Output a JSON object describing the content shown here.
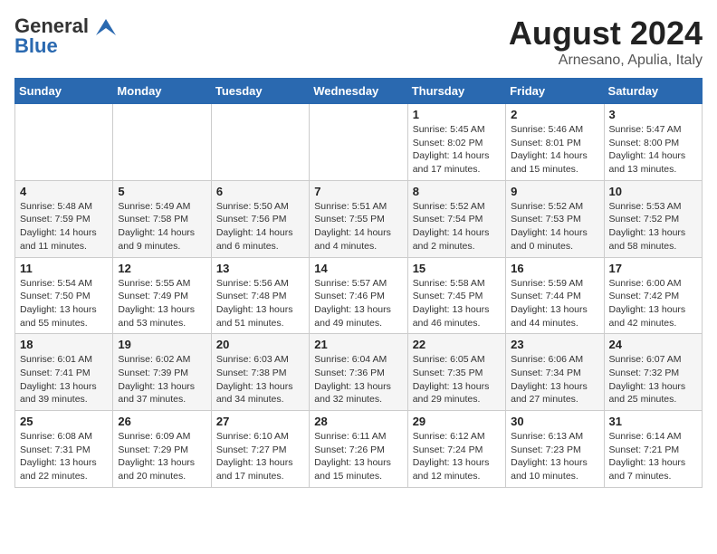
{
  "header": {
    "logo_general": "General",
    "logo_blue": "Blue",
    "month_year": "August 2024",
    "location": "Arnesano, Apulia, Italy"
  },
  "weekdays": [
    "Sunday",
    "Monday",
    "Tuesday",
    "Wednesday",
    "Thursday",
    "Friday",
    "Saturday"
  ],
  "weeks": [
    [
      {
        "day": "",
        "info": ""
      },
      {
        "day": "",
        "info": ""
      },
      {
        "day": "",
        "info": ""
      },
      {
        "day": "",
        "info": ""
      },
      {
        "day": "1",
        "info": "Sunrise: 5:45 AM\nSunset: 8:02 PM\nDaylight: 14 hours\nand 17 minutes."
      },
      {
        "day": "2",
        "info": "Sunrise: 5:46 AM\nSunset: 8:01 PM\nDaylight: 14 hours\nand 15 minutes."
      },
      {
        "day": "3",
        "info": "Sunrise: 5:47 AM\nSunset: 8:00 PM\nDaylight: 14 hours\nand 13 minutes."
      }
    ],
    [
      {
        "day": "4",
        "info": "Sunrise: 5:48 AM\nSunset: 7:59 PM\nDaylight: 14 hours\nand 11 minutes."
      },
      {
        "day": "5",
        "info": "Sunrise: 5:49 AM\nSunset: 7:58 PM\nDaylight: 14 hours\nand 9 minutes."
      },
      {
        "day": "6",
        "info": "Sunrise: 5:50 AM\nSunset: 7:56 PM\nDaylight: 14 hours\nand 6 minutes."
      },
      {
        "day": "7",
        "info": "Sunrise: 5:51 AM\nSunset: 7:55 PM\nDaylight: 14 hours\nand 4 minutes."
      },
      {
        "day": "8",
        "info": "Sunrise: 5:52 AM\nSunset: 7:54 PM\nDaylight: 14 hours\nand 2 minutes."
      },
      {
        "day": "9",
        "info": "Sunrise: 5:52 AM\nSunset: 7:53 PM\nDaylight: 14 hours\nand 0 minutes."
      },
      {
        "day": "10",
        "info": "Sunrise: 5:53 AM\nSunset: 7:52 PM\nDaylight: 13 hours\nand 58 minutes."
      }
    ],
    [
      {
        "day": "11",
        "info": "Sunrise: 5:54 AM\nSunset: 7:50 PM\nDaylight: 13 hours\nand 55 minutes."
      },
      {
        "day": "12",
        "info": "Sunrise: 5:55 AM\nSunset: 7:49 PM\nDaylight: 13 hours\nand 53 minutes."
      },
      {
        "day": "13",
        "info": "Sunrise: 5:56 AM\nSunset: 7:48 PM\nDaylight: 13 hours\nand 51 minutes."
      },
      {
        "day": "14",
        "info": "Sunrise: 5:57 AM\nSunset: 7:46 PM\nDaylight: 13 hours\nand 49 minutes."
      },
      {
        "day": "15",
        "info": "Sunrise: 5:58 AM\nSunset: 7:45 PM\nDaylight: 13 hours\nand 46 minutes."
      },
      {
        "day": "16",
        "info": "Sunrise: 5:59 AM\nSunset: 7:44 PM\nDaylight: 13 hours\nand 44 minutes."
      },
      {
        "day": "17",
        "info": "Sunrise: 6:00 AM\nSunset: 7:42 PM\nDaylight: 13 hours\nand 42 minutes."
      }
    ],
    [
      {
        "day": "18",
        "info": "Sunrise: 6:01 AM\nSunset: 7:41 PM\nDaylight: 13 hours\nand 39 minutes."
      },
      {
        "day": "19",
        "info": "Sunrise: 6:02 AM\nSunset: 7:39 PM\nDaylight: 13 hours\nand 37 minutes."
      },
      {
        "day": "20",
        "info": "Sunrise: 6:03 AM\nSunset: 7:38 PM\nDaylight: 13 hours\nand 34 minutes."
      },
      {
        "day": "21",
        "info": "Sunrise: 6:04 AM\nSunset: 7:36 PM\nDaylight: 13 hours\nand 32 minutes."
      },
      {
        "day": "22",
        "info": "Sunrise: 6:05 AM\nSunset: 7:35 PM\nDaylight: 13 hours\nand 29 minutes."
      },
      {
        "day": "23",
        "info": "Sunrise: 6:06 AM\nSunset: 7:34 PM\nDaylight: 13 hours\nand 27 minutes."
      },
      {
        "day": "24",
        "info": "Sunrise: 6:07 AM\nSunset: 7:32 PM\nDaylight: 13 hours\nand 25 minutes."
      }
    ],
    [
      {
        "day": "25",
        "info": "Sunrise: 6:08 AM\nSunset: 7:31 PM\nDaylight: 13 hours\nand 22 minutes."
      },
      {
        "day": "26",
        "info": "Sunrise: 6:09 AM\nSunset: 7:29 PM\nDaylight: 13 hours\nand 20 minutes."
      },
      {
        "day": "27",
        "info": "Sunrise: 6:10 AM\nSunset: 7:27 PM\nDaylight: 13 hours\nand 17 minutes."
      },
      {
        "day": "28",
        "info": "Sunrise: 6:11 AM\nSunset: 7:26 PM\nDaylight: 13 hours\nand 15 minutes."
      },
      {
        "day": "29",
        "info": "Sunrise: 6:12 AM\nSunset: 7:24 PM\nDaylight: 13 hours\nand 12 minutes."
      },
      {
        "day": "30",
        "info": "Sunrise: 6:13 AM\nSunset: 7:23 PM\nDaylight: 13 hours\nand 10 minutes."
      },
      {
        "day": "31",
        "info": "Sunrise: 6:14 AM\nSunset: 7:21 PM\nDaylight: 13 hours\nand 7 minutes."
      }
    ]
  ]
}
